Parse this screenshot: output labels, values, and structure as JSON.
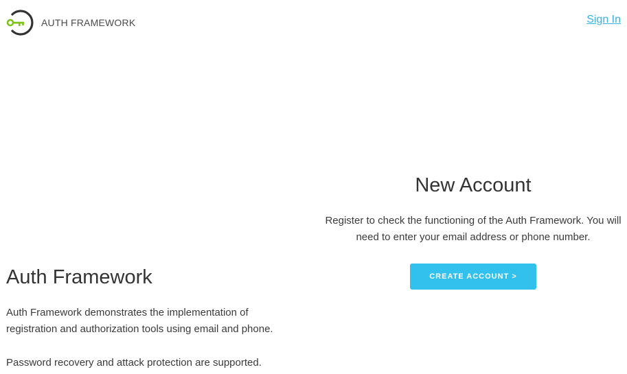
{
  "header": {
    "brand": "AUTH FRAMEWORK",
    "signin_label": "Sign In"
  },
  "new_account": {
    "title": "New Account",
    "description": "Register to check the functioning of the Auth Framework. You will need to enter your email address or phone number.",
    "button_label": "CREATE ACCOUNT >"
  },
  "about": {
    "title": "Auth Framework",
    "paragraph1": "Auth Framework demonstrates the implementation of registration and authorization tools using email and phone.",
    "paragraph2": "Password recovery and attack protection are supported."
  },
  "colors": {
    "accent": "#32c0ec",
    "link": "#37b2e0",
    "logo_key": "#7dc41a",
    "logo_ring": "#333333"
  },
  "icons": {
    "logo": "key-icon"
  }
}
